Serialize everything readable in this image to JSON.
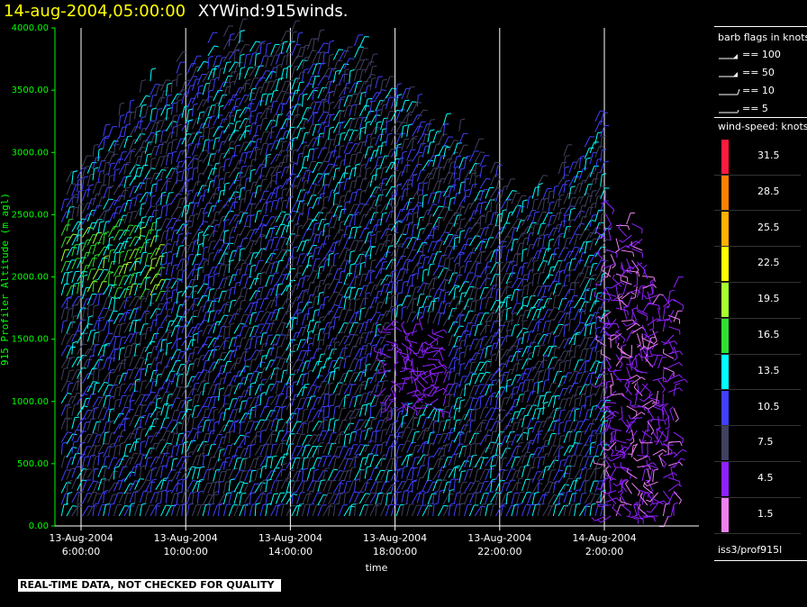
{
  "title": {
    "date_label": "14-aug-2004,05:00:00",
    "dataset_label": "XYWind:915winds."
  },
  "chart_data": {
    "type": "wind-barb",
    "ylabel": "915 Profiler Altitude (m agl)",
    "xlabel": "time",
    "ylim": [
      0,
      4000
    ],
    "y_ticks": [
      "0.00",
      "500.00",
      "1000.00",
      "1500.00",
      "2000.00",
      "2500.00",
      "3000.00",
      "3500.00",
      "4000.00"
    ],
    "x_ticks": [
      {
        "date": "13-Aug-2004",
        "time": "6:00:00"
      },
      {
        "date": "13-Aug-2004",
        "time": "10:00:00"
      },
      {
        "date": "13-Aug-2004",
        "time": "14:00:00"
      },
      {
        "date": "13-Aug-2004",
        "time": "18:00:00"
      },
      {
        "date": "13-Aug-2004",
        "time": "22:00:00"
      },
      {
        "date": "14-Aug-2004",
        "time": "2:00:00"
      }
    ],
    "x_range_hours": [
      5.0,
      29.0
    ],
    "tick_hours": [
      6,
      10,
      14,
      18,
      22,
      26
    ],
    "grid": "vertical lines at x ticks",
    "colors": {
      "axis": "#00ff00",
      "grid": "#ffffff",
      "title_date": "#ffff00"
    }
  },
  "legend": {
    "barb_title": "barb flags in knots",
    "barbs": [
      {
        "label": "== 100",
        "kind": "flag"
      },
      {
        "label": "== 50",
        "kind": "flag"
      },
      {
        "label": "== 10",
        "kind": "full"
      },
      {
        "label": "== 5",
        "kind": "half"
      }
    ],
    "speed_title": "wind-speed: knots",
    "speed_bins": [
      {
        "label": "31.5",
        "color": "#ff1a40"
      },
      {
        "label": "28.5",
        "color": "#ff7f00"
      },
      {
        "label": "25.5",
        "color": "#ffb000"
      },
      {
        "label": "22.5",
        "color": "#ffff00"
      },
      {
        "label": "19.5",
        "color": "#a8ff30"
      },
      {
        "label": "16.5",
        "color": "#30e030"
      },
      {
        "label": "13.5",
        "color": "#00ffff"
      },
      {
        "label": "10.5",
        "color": "#4040ff"
      },
      {
        "label": "7.5",
        "color": "#404060"
      },
      {
        "label": "4.5",
        "color": "#9020ff"
      },
      {
        "label": "1.5",
        "color": "#f080f0"
      }
    ]
  },
  "footer": {
    "source": "iss3/prof915l",
    "notice": "REAL-TIME DATA, NOT CHECKED FOR QUALITY"
  }
}
